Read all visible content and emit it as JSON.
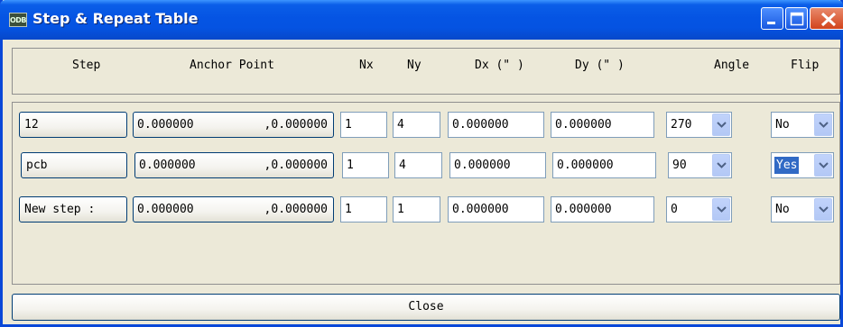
{
  "window": {
    "title": "Step & Repeat Table",
    "app_icon_text": "ODB",
    "buttons": [
      "minimize-icon",
      "maximize-icon",
      "close-icon"
    ]
  },
  "columns": [
    "Step",
    "Anchor Point",
    "Nx",
    "Ny",
    "Dx (\" )",
    "Dy (\" )",
    "Angle",
    "Flip"
  ],
  "rows": [
    {
      "step": "12",
      "anchor_x": "0.000000",
      "anchor_y": ",0.000000",
      "nx": "1",
      "ny": "4",
      "dx": "0.000000",
      "dy": "0.000000",
      "angle": "270",
      "flip": "No",
      "flip_selected": false
    },
    {
      "step": "pcb",
      "anchor_x": "0.000000",
      "anchor_y": ",0.000000",
      "nx": "1",
      "ny": "4",
      "dx": "0.000000",
      "dy": "0.000000",
      "angle": "90",
      "flip": "Yes",
      "flip_selected": true
    },
    {
      "step": "New step :",
      "anchor_x": "0.000000",
      "anchor_y": ",0.000000",
      "nx": "1",
      "ny": "1",
      "dx": "0.000000",
      "dy": "0.000000",
      "angle": "0",
      "flip": "No",
      "flip_selected": false
    }
  ],
  "close_label": "Close",
  "colors": {
    "titlebar": "#0554e3",
    "selection": "#316ac5",
    "face": "#ece9d8"
  }
}
